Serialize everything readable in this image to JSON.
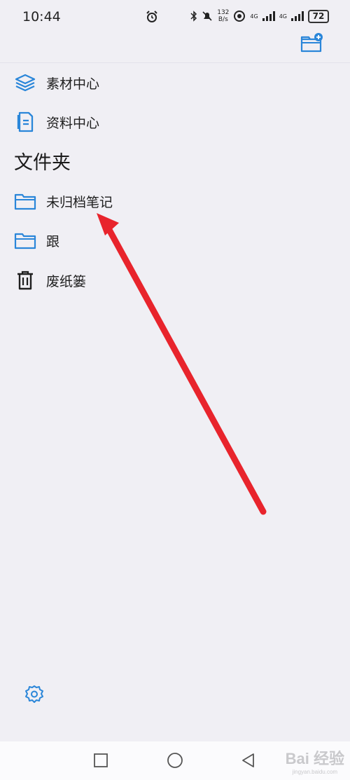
{
  "status_bar": {
    "time": "10:44",
    "net_speed_value": "132",
    "net_speed_unit": "B/s",
    "net_type_1": "4G",
    "net_type_2": "4G",
    "battery": "72"
  },
  "colors": {
    "accent": "#2a86d9",
    "background": "#f0eff4",
    "annotation_arrow": "#e8242c"
  },
  "menu": {
    "items": [
      {
        "label": "素材中心",
        "icon": "layers-icon"
      },
      {
        "label": "资料中心",
        "icon": "document-icon"
      }
    ]
  },
  "folders": {
    "title": "文件夹",
    "items": [
      {
        "label": "未归档笔记",
        "icon": "folder-icon"
      },
      {
        "label": "跟",
        "icon": "folder-icon"
      },
      {
        "label": "废纸篓",
        "icon": "trash-icon"
      }
    ]
  },
  "watermark": {
    "text": "Bai 经验",
    "sub": "jingyan.baidu.com"
  }
}
